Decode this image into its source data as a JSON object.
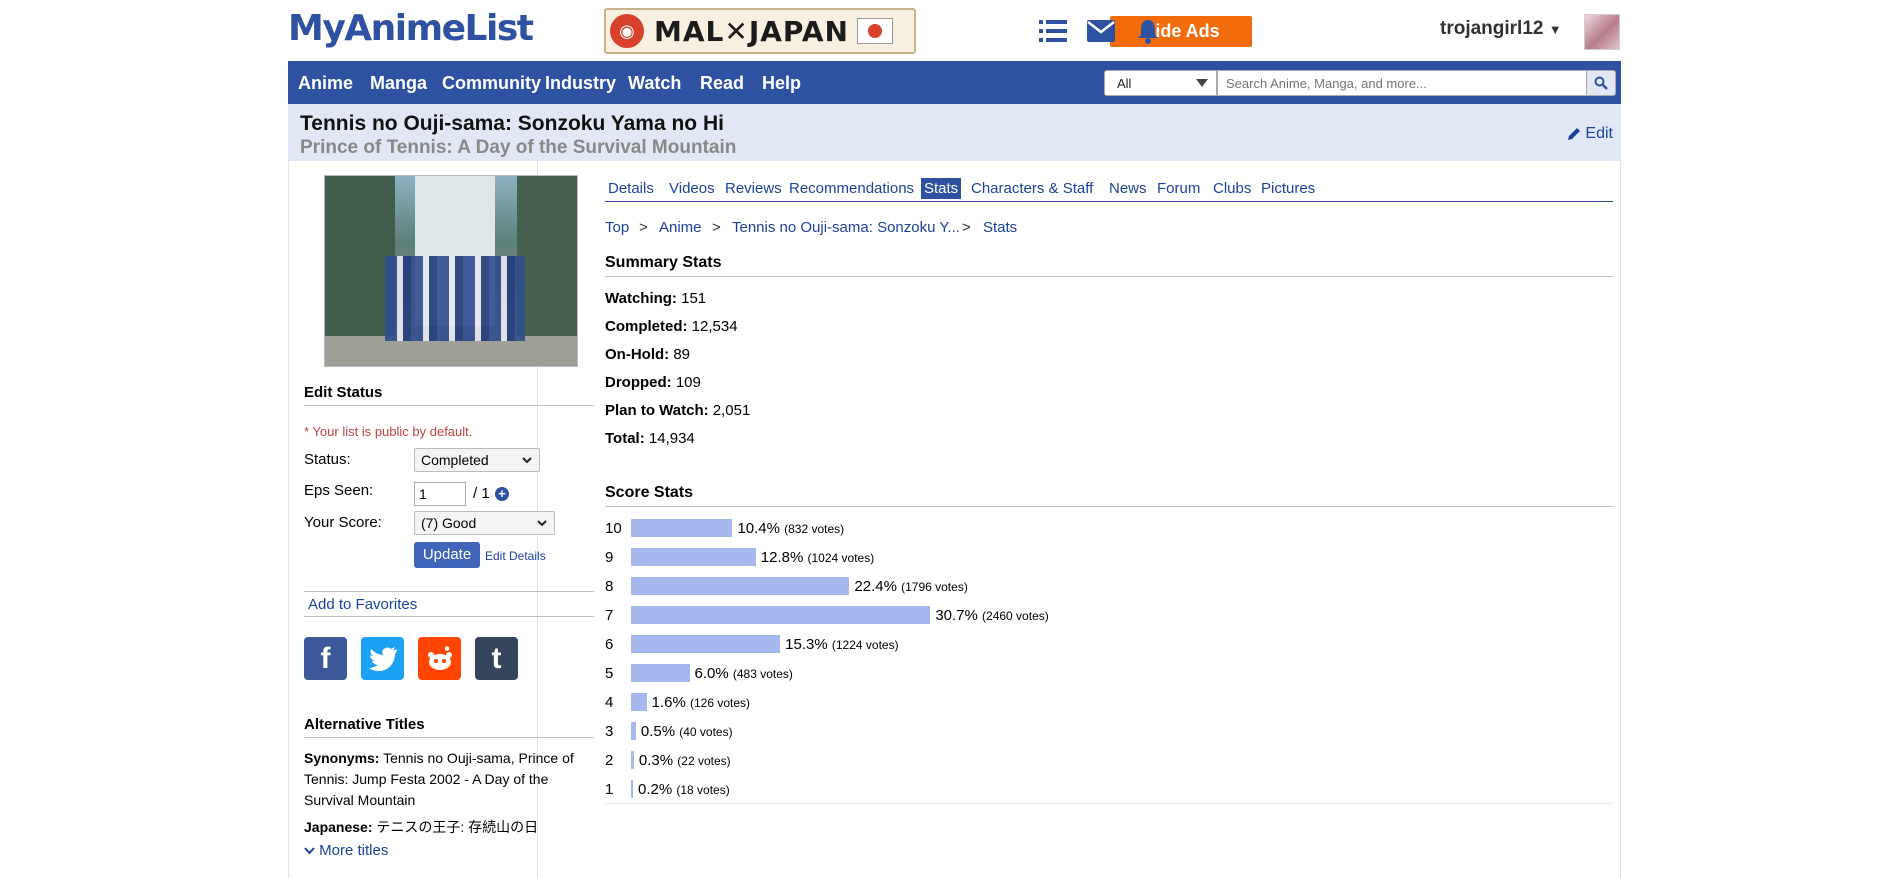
{
  "header": {
    "logo": "MyAnimeList",
    "banner_text": "MAL✕JAPAN",
    "hide_ads": "Hide Ads",
    "username": "trojangirl12"
  },
  "nav": {
    "items": [
      "Anime",
      "Manga",
      "Community",
      "Industry",
      "Watch",
      "Read",
      "Help"
    ],
    "search_select": "All",
    "search_placeholder": "Search Anime, Manga, and more..."
  },
  "title": {
    "main": "Tennis no Ouji-sama: Sonzoku Yama no Hi",
    "english": "Prince of Tennis: A Day of the Survival Mountain",
    "edit": "Edit"
  },
  "sidebar": {
    "edit_status_heading": "Edit Status",
    "public_note": "* Your list is public by default.",
    "status_label": "Status:",
    "status_value": "Completed",
    "eps_label": "Eps Seen:",
    "eps_value": "1",
    "eps_total": "/ 1",
    "score_label": "Your Score:",
    "score_value": "(7) Good",
    "update": "Update",
    "edit_details": "Edit Details",
    "add_favorites": "Add to Favorites",
    "alt_heading": "Alternative Titles",
    "synonyms_label": "Synonyms:",
    "synonyms_value": "Tennis no Ouji-sama, Prince of Tennis: Jump Festa 2002 - A Day of the Survival Mountain",
    "japanese_label": "Japanese:",
    "japanese_value": "テニスの王子: 存続山の日",
    "more_titles": "More titles"
  },
  "tabs": [
    "Details",
    "Videos",
    "Reviews",
    "Recommendations",
    "Stats",
    "Characters & Staff",
    "News",
    "Forum",
    "Clubs",
    "Pictures"
  ],
  "active_tab": "Stats",
  "breadcrumb": [
    "Top",
    "Anime",
    "Tennis no Ouji-sama: Sonzoku Y...",
    "Stats"
  ],
  "summary": {
    "heading": "Summary Stats",
    "rows": [
      {
        "label": "Watching:",
        "value": "151"
      },
      {
        "label": "Completed:",
        "value": "12,534"
      },
      {
        "label": "On-Hold:",
        "value": "89"
      },
      {
        "label": "Dropped:",
        "value": "109"
      },
      {
        "label": "Plan to Watch:",
        "value": "2,051"
      },
      {
        "label": "Total:",
        "value": "14,934"
      }
    ]
  },
  "score_stats": {
    "heading": "Score Stats",
    "bar_color": "#a5b9ef",
    "rows": [
      {
        "score": "10",
        "percent": 10.4,
        "pct_text": "10.4%",
        "votes": "(832 votes)"
      },
      {
        "score": "9",
        "percent": 12.8,
        "pct_text": "12.8%",
        "votes": "(1024 votes)"
      },
      {
        "score": "8",
        "percent": 22.4,
        "pct_text": "22.4%",
        "votes": "(1796 votes)"
      },
      {
        "score": "7",
        "percent": 30.7,
        "pct_text": "30.7%",
        "votes": "(2460 votes)"
      },
      {
        "score": "6",
        "percent": 15.3,
        "pct_text": "15.3%",
        "votes": "(1224 votes)"
      },
      {
        "score": "5",
        "percent": 6.0,
        "pct_text": "6.0%",
        "votes": "(483 votes)"
      },
      {
        "score": "4",
        "percent": 1.6,
        "pct_text": "1.6%",
        "votes": "(126 votes)"
      },
      {
        "score": "3",
        "percent": 0.5,
        "pct_text": "0.5%",
        "votes": "(40 votes)"
      },
      {
        "score": "2",
        "percent": 0.3,
        "pct_text": "0.3%",
        "votes": "(22 votes)"
      },
      {
        "score": "1",
        "percent": 0.2,
        "pct_text": "0.2%",
        "votes": "(18 votes)"
      }
    ]
  },
  "colors": {
    "brand_blue": "#2e51a2",
    "hide_ads_orange": "#f26b0c",
    "link_blue": "#1c439b"
  }
}
